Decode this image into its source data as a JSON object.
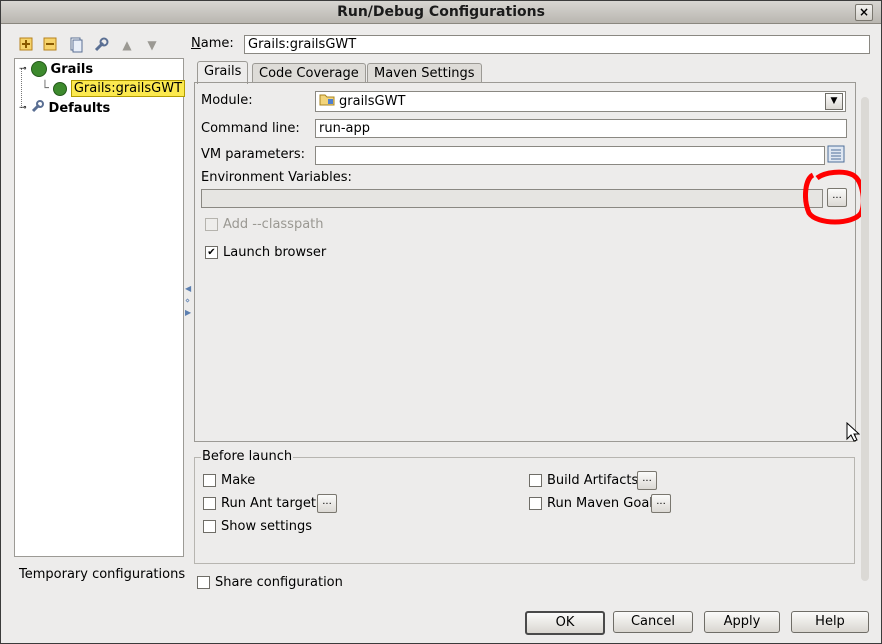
{
  "window": {
    "title": "Run/Debug Configurations",
    "close_glyph": "×"
  },
  "toolbar": {
    "icons": [
      "add-icon",
      "remove-icon",
      "copy-icon",
      "wrench-icon",
      "arrow-up-icon",
      "arrow-down-icon"
    ]
  },
  "tree": {
    "items": [
      {
        "label": "Grails",
        "selected": false
      },
      {
        "label": "Grails:grailsGWT",
        "selected": true
      },
      {
        "label": "Defaults",
        "selected": false
      }
    ]
  },
  "temp_configs_label": "Temporary configurations",
  "name": {
    "label": "Name:",
    "value": "Grails:grailsGWT"
  },
  "tabs": [
    "Grails",
    "Code Coverage",
    "Maven Settings"
  ],
  "form": {
    "module_label": "Module:",
    "module_value": "grailsGWT",
    "command_label": "Command line:",
    "command_value": "run-app",
    "vm_label": "VM parameters:",
    "vm_value": "",
    "env_label": "Environment Variables:",
    "env_value": "",
    "browse_label": "...",
    "add_classpath": "Add --classpath",
    "launch_browser": "Launch browser"
  },
  "before_launch": {
    "title": "Before launch",
    "make": "Make",
    "run_ant": "Run Ant target",
    "show_settings": "Show settings",
    "build_artifacts": "Build Artifacts",
    "run_maven": "Run Maven Goal"
  },
  "share_config": "Share configuration",
  "buttons": {
    "ok": "OK",
    "cancel": "Cancel",
    "apply": "Apply",
    "help": "Help"
  },
  "colors": {
    "annotation": "#ff0000",
    "selection": "#fce94f"
  }
}
